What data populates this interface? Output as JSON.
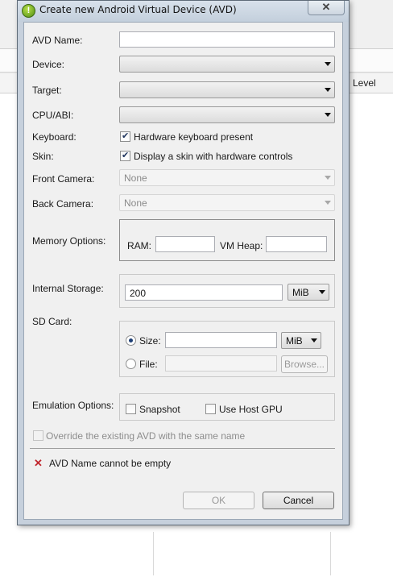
{
  "background": {
    "column_header": "Level"
  },
  "dialog": {
    "title": "Create new Android Virtual Device (AVD)",
    "close_glyph": "✕",
    "avd_name": {
      "label": "AVD Name:",
      "value": ""
    },
    "device": {
      "label": "Device:",
      "value": ""
    },
    "target": {
      "label": "Target:",
      "value": ""
    },
    "cpu_abi": {
      "label": "CPU/ABI:",
      "value": ""
    },
    "keyboard": {
      "label": "Keyboard:",
      "checkbox_label": "Hardware keyboard present",
      "checked": true
    },
    "skin": {
      "label": "Skin:",
      "checkbox_label": "Display a skin with hardware controls",
      "checked": true
    },
    "front_camera": {
      "label": "Front Camera:",
      "value": "None"
    },
    "back_camera": {
      "label": "Back Camera:",
      "value": "None"
    },
    "memory": {
      "label": "Memory Options:",
      "ram_label": "RAM:",
      "ram_value": "",
      "vm_heap_label": "VM Heap:",
      "vm_heap_value": ""
    },
    "internal_storage": {
      "label": "Internal Storage:",
      "value": "200",
      "unit": "MiB"
    },
    "sd_card": {
      "label": "SD Card:",
      "size_label": "Size:",
      "size_value": "",
      "size_unit": "MiB",
      "size_selected": true,
      "file_label": "File:",
      "file_value": "",
      "browse_label": "Browse..."
    },
    "emulation": {
      "label": "Emulation Options:",
      "snapshot_label": "Snapshot",
      "host_gpu_label": "Use Host GPU"
    },
    "override_label": "Override the existing AVD with the same name",
    "error_message": "AVD Name cannot be empty",
    "ok_label": "OK",
    "cancel_label": "Cancel"
  }
}
